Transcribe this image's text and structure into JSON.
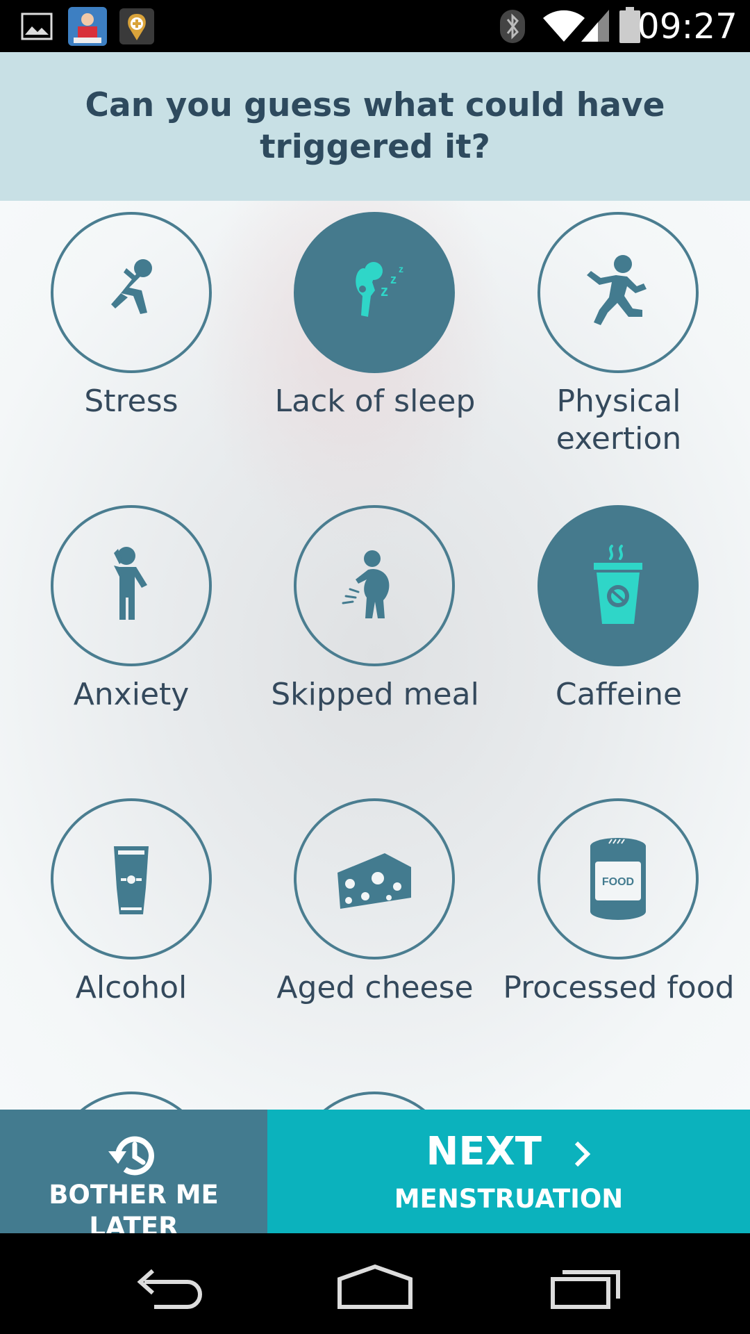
{
  "status_bar": {
    "time": "09:27",
    "icons": [
      "image-notification-icon",
      "app-notification-icon",
      "health-app-icon",
      "bluetooth-icon",
      "wifi-icon",
      "signal-icon",
      "battery-icon"
    ]
  },
  "question": "Can you guess what could have triggered it?",
  "triggers": [
    {
      "label": "Stress",
      "icon": "stress-icon",
      "selected": false
    },
    {
      "label": "Lack of sleep",
      "icon": "sleep-icon",
      "selected": true
    },
    {
      "label": "Physical exertion",
      "icon": "running-icon",
      "selected": false
    },
    {
      "label": "Anxiety",
      "icon": "anxiety-icon",
      "selected": false
    },
    {
      "label": "Skipped meal",
      "icon": "hungry-icon",
      "selected": false
    },
    {
      "label": "Caffeine",
      "icon": "coffee-icon",
      "selected": true
    },
    {
      "label": "Alcohol",
      "icon": "beer-glass-icon",
      "selected": false
    },
    {
      "label": "Aged cheese",
      "icon": "cheese-icon",
      "selected": false
    },
    {
      "label": "Processed food",
      "icon": "food-can-icon",
      "selected": false
    }
  ],
  "can_label": "FOOD",
  "buttons": {
    "later": "BOTHER ME LATER",
    "next": "NEXT",
    "next_sub": "MENSTRUATION"
  },
  "colors": {
    "accent_dark": "#437b8f",
    "accent_teal": "#0bb2bd",
    "selected_icon": "#2fd6c8",
    "header_bg": "#c8e0e5",
    "text": "#34495c"
  }
}
